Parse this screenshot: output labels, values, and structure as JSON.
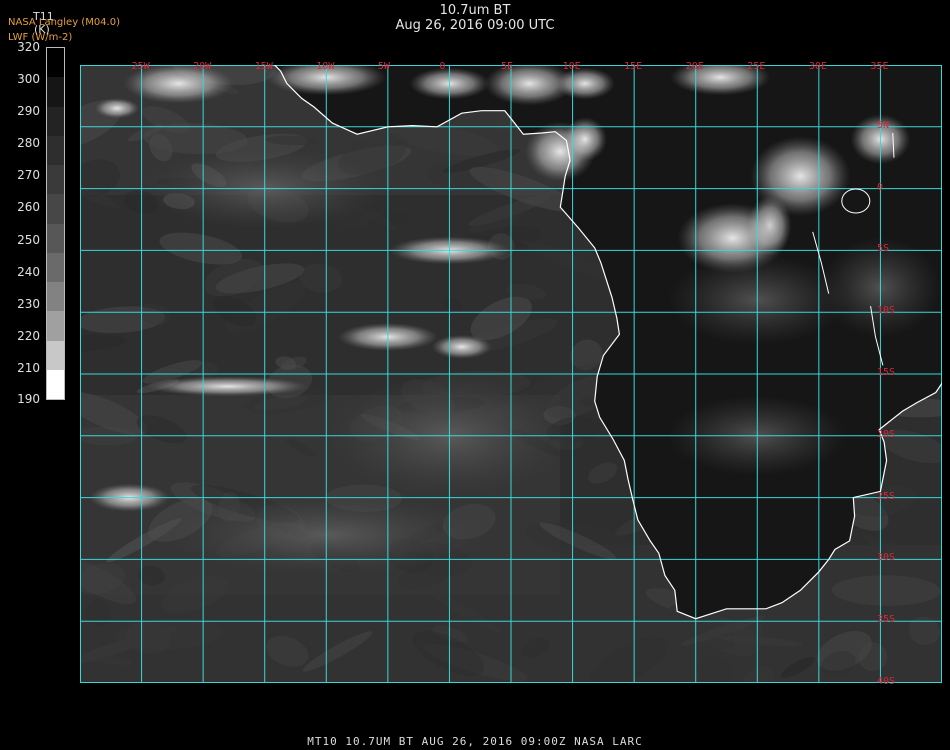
{
  "header": {
    "title": "10.7um BT",
    "datetime": "Aug 26, 2016 09:00 UTC",
    "credit_line1": "NASA Langley (M04.0)",
    "credit_line2": "LWF (W/m-2)"
  },
  "colorbar": {
    "variable": "T11",
    "unit": "(K)",
    "ticks": [
      "320",
      "300",
      "290",
      "280",
      "270",
      "260",
      "250",
      "240",
      "230",
      "220",
      "210",
      "190"
    ],
    "gradient": [
      "#000000",
      "#151515",
      "#232323",
      "#2e2e2e",
      "#3a3a3a",
      "#474747",
      "#575757",
      "#6a6a6a",
      "#828282",
      "#a0a0a0",
      "#c8c8c8",
      "#ffffff"
    ]
  },
  "map": {
    "extent": {
      "lon": [
        -30,
        40
      ],
      "lat": [
        10,
        -40
      ]
    },
    "longitude_labels": [
      "25W",
      "20W",
      "15W",
      "10W",
      "5W",
      "0",
      "5E",
      "10E",
      "15E",
      "20E",
      "25E",
      "30E",
      "35E"
    ],
    "latitude_labels": [
      "5N",
      "0",
      "5S",
      "10S",
      "15S",
      "20S",
      "25S",
      "30S",
      "35S",
      "40S"
    ],
    "grid_color": "#38d8d8",
    "label_color": "#d8283a",
    "coast_color": "#ffffff"
  },
  "footer": "MT10   10.7UM BT    AUG 26, 2016 09:00Z   NASA LARC"
}
